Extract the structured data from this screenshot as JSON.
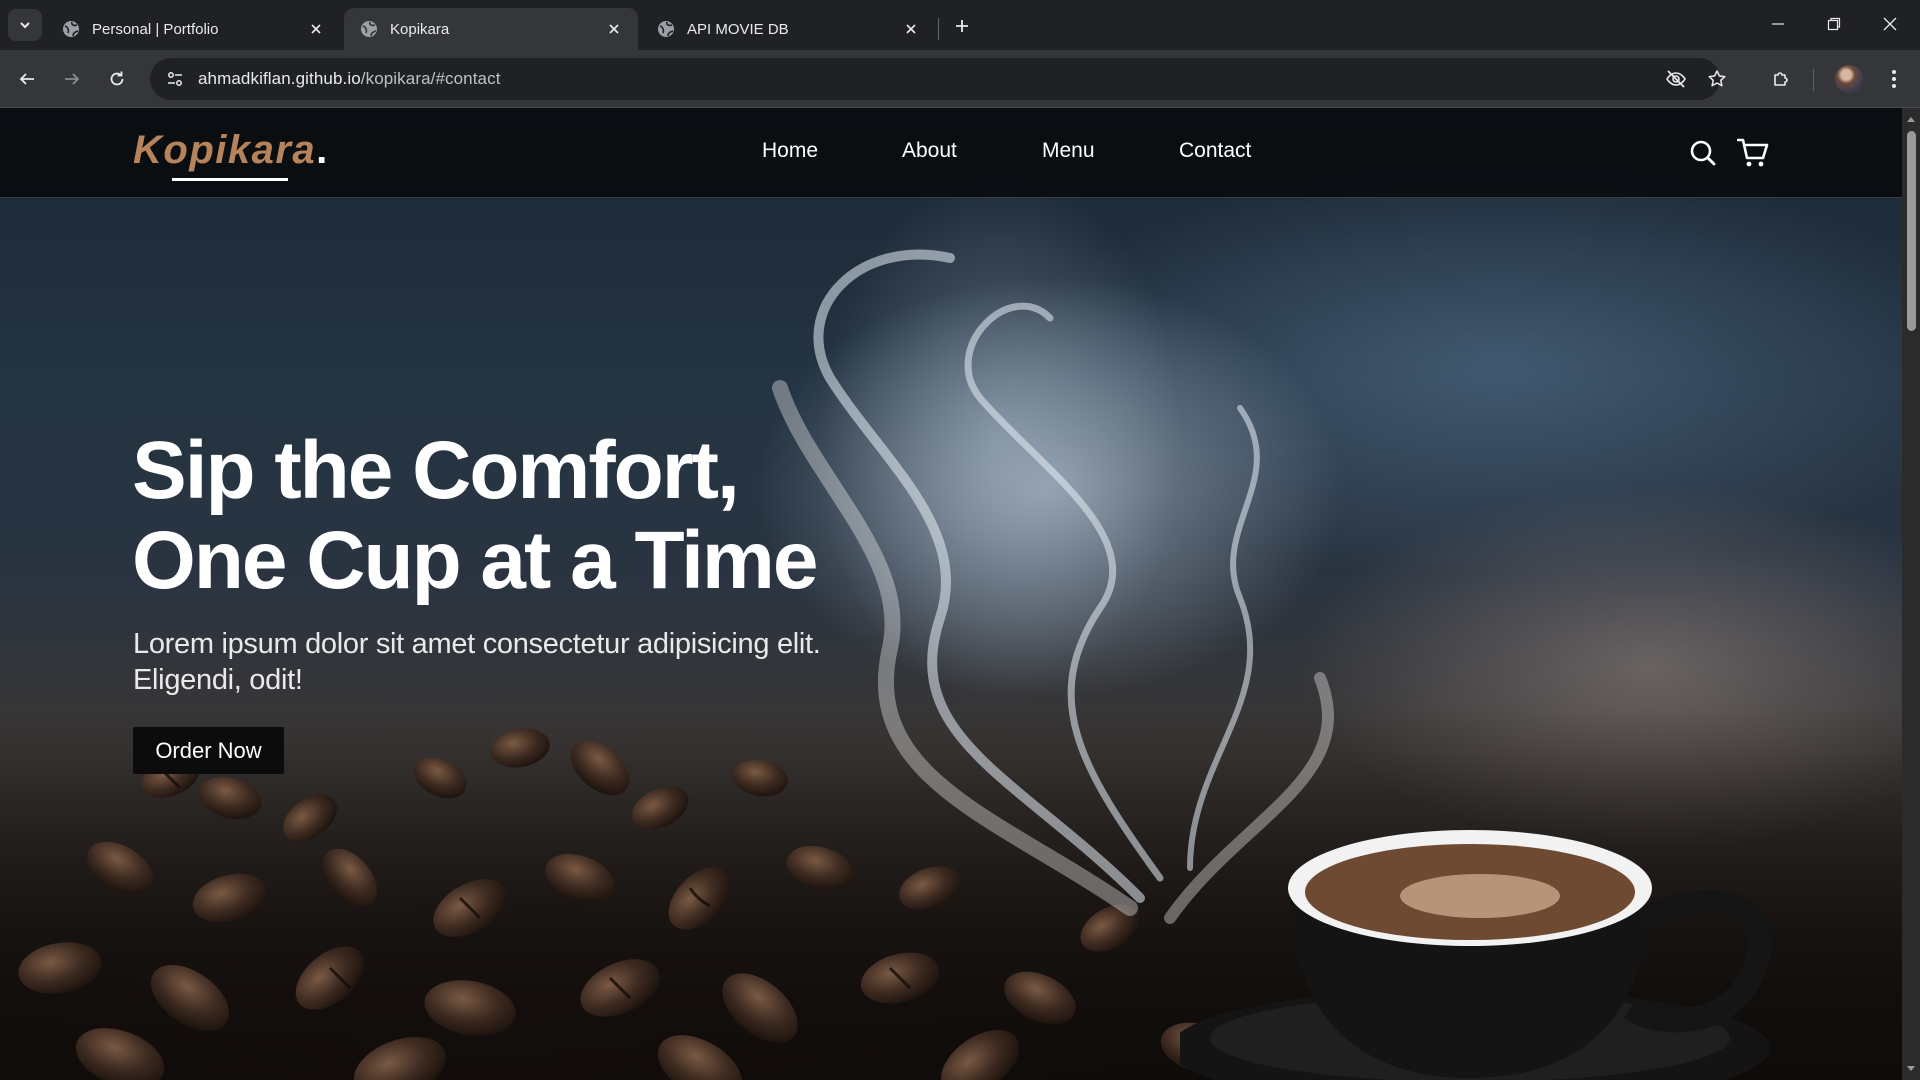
{
  "browser": {
    "tabs": [
      {
        "title": "Personal | Portfolio",
        "active": false
      },
      {
        "title": "Kopikara",
        "active": true
      },
      {
        "title": "API MOVIE DB",
        "active": false
      }
    ],
    "url_host": "ahmadkiflan.github.io",
    "url_path": "/kopikara/#contact",
    "icons": [
      "tab-search-icon",
      "globe-icon",
      "close-icon",
      "new-tab-icon",
      "minimize-icon",
      "restore-icon",
      "window-close-icon",
      "back-arrow-icon",
      "forward-arrow-icon",
      "reload-icon",
      "site-settings-icon",
      "eye-off-icon",
      "star-icon",
      "extensions-icon",
      "profile-avatar",
      "more-menu-icon"
    ]
  },
  "site": {
    "logo_text": "Kopikara",
    "logo_dot": ".",
    "logo_color": "#b6835a",
    "nav": [
      {
        "label": "Home"
      },
      {
        "label": "About"
      },
      {
        "label": "Menu"
      },
      {
        "label": "Contact"
      }
    ],
    "nav_icons": [
      "search-icon",
      "shopping-cart-icon"
    ],
    "hero": {
      "title_line1": "Sip the Comfort,",
      "title_line2": "One Cup at a Time",
      "subtitle_line1": "Lorem ipsum dolor sit amet consectetur adipisicing elit.",
      "subtitle_line2": "Eligendi, odit!",
      "cta_label": "Order Now"
    }
  }
}
